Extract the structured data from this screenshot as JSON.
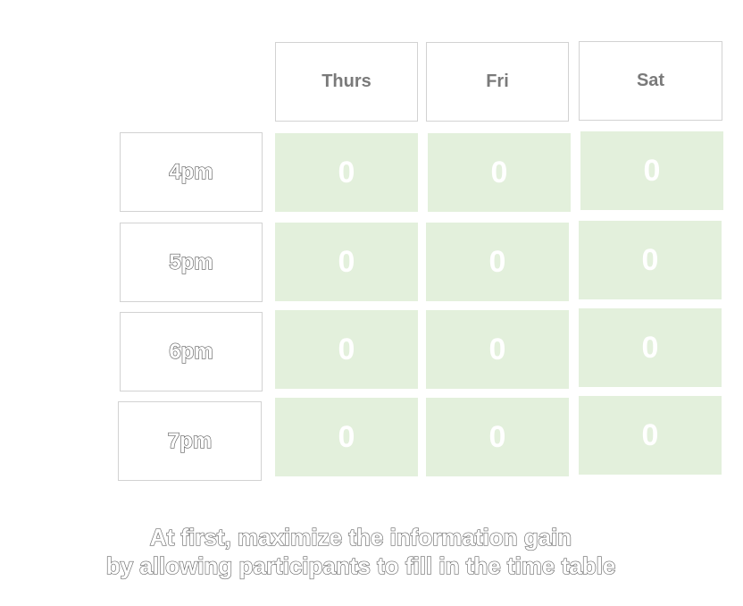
{
  "days": [
    "Thurs",
    "Fri",
    "Sat"
  ],
  "times": [
    "4pm",
    "5pm",
    "6pm",
    "7pm"
  ],
  "cells": [
    [
      "0",
      "0",
      "0"
    ],
    [
      "0",
      "0",
      "0"
    ],
    [
      "0",
      "0",
      "0"
    ],
    [
      "0",
      "0",
      "0"
    ]
  ],
  "caption": {
    "line1": "At first, maximize the information gain",
    "line2": "by allowing participants to fill in the time table"
  },
  "colors": {
    "cell_background": "#e3f0dc",
    "header_border": "#d2d2d2",
    "header_text": "#7a7a7a"
  }
}
